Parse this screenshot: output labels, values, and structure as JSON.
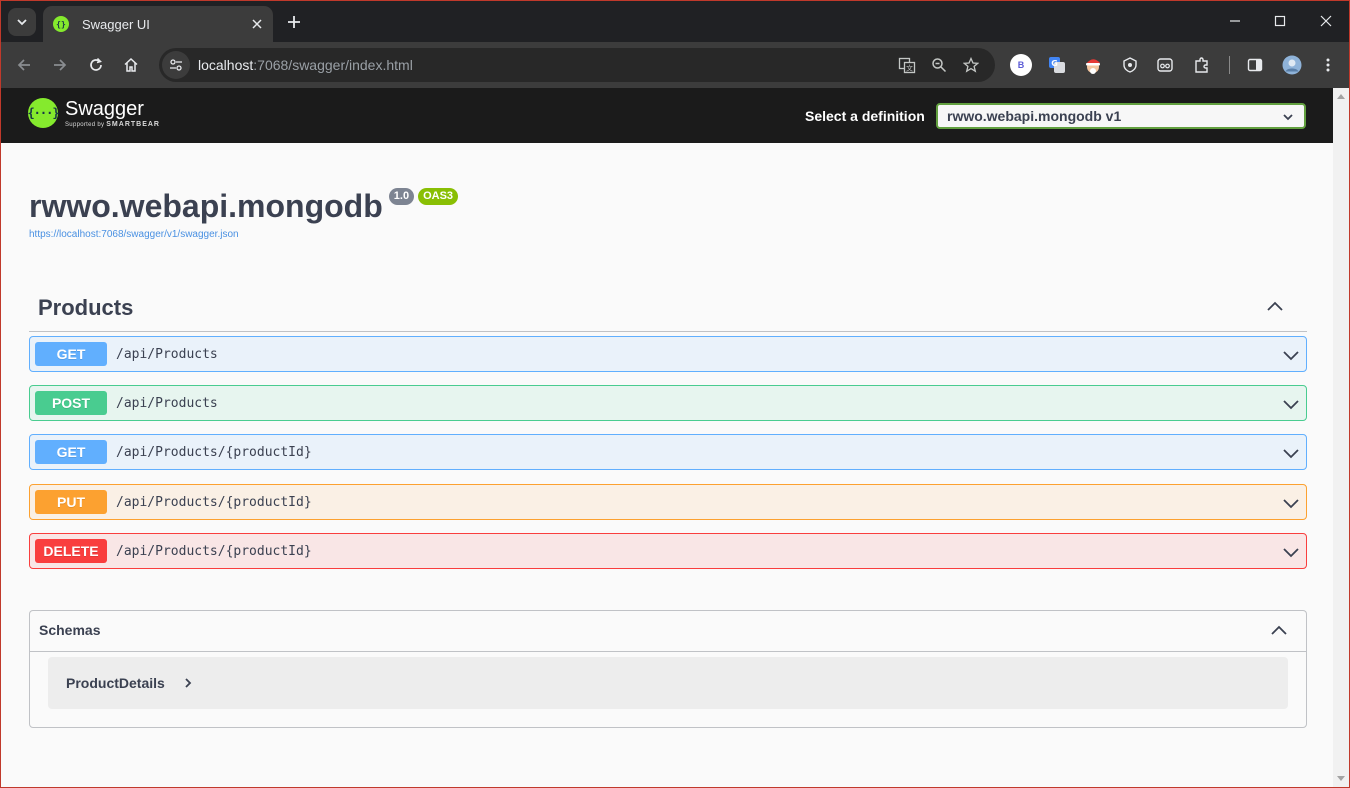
{
  "browser": {
    "tab_title": "Swagger UI",
    "url_host": "localhost",
    "url_rest": ":7068/swagger/index.html",
    "profile_badge": "B"
  },
  "swagger": {
    "logo_name": "Swagger",
    "logo_sub_prefix": "Supported by",
    "logo_sub_brand": "SMARTBEAR",
    "definition_label": "Select a definition",
    "definition_value": "rwwo.webapi.mongodb v1",
    "title": "rwwo.webapi.mongodb",
    "version": "1.0",
    "oas_badge": "OAS3",
    "spec_url": "https://localhost:7068/swagger/v1/swagger.json",
    "section": "Products",
    "operations": [
      {
        "method": "GET",
        "path": "/api/Products"
      },
      {
        "method": "POST",
        "path": "/api/Products"
      },
      {
        "method": "GET",
        "path": "/api/Products/{productId}"
      },
      {
        "method": "PUT",
        "path": "/api/Products/{productId}"
      },
      {
        "method": "DELETE",
        "path": "/api/Products/{productId}"
      }
    ],
    "schemas_title": "Schemas",
    "models": [
      "ProductDetails"
    ]
  },
  "colors": {
    "get": "#61affe",
    "post": "#49cc90",
    "put": "#fca130",
    "delete": "#f93e3e",
    "swagger_green": "#85ea2d"
  }
}
